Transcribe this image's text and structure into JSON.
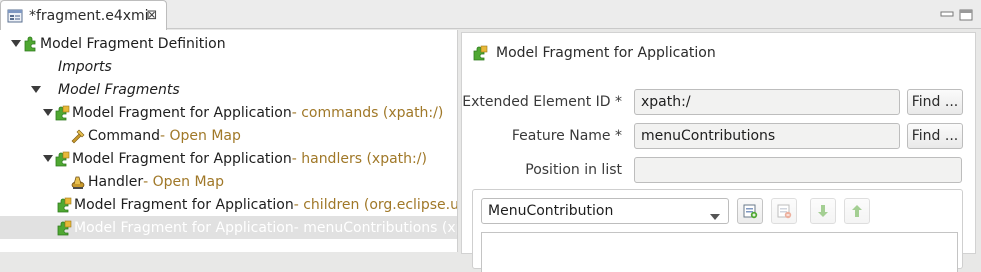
{
  "tab": {
    "title": "*fragment.e4xmi",
    "close_glyph": "⊠"
  },
  "tree": {
    "rows": [
      {
        "main": "Model Fragment Definition",
        "detail": ""
      },
      {
        "main": "Imports",
        "detail": ""
      },
      {
        "main": "Model Fragments",
        "detail": ""
      },
      {
        "main": "Model Fragment for Application",
        "detail": " - commands (xpath:/)"
      },
      {
        "main": "Command",
        "detail": " - Open Map"
      },
      {
        "main": "Model Fragment for Application",
        "detail": " - handlers (xpath:/)"
      },
      {
        "main": "Handler",
        "detail": " - Open Map"
      },
      {
        "main": "Model Fragment for Application",
        "detail": " - children (org.eclipse.ui."
      },
      {
        "main": "Model Fragment for Application",
        "detail": " - menuContributions (xpa"
      }
    ]
  },
  "details": {
    "header": "Model Fragment for Application",
    "extended_element_id": {
      "label": "Extended Element ID *",
      "value": "xpath:/",
      "button": "Find ..."
    },
    "feature_name": {
      "label": "Feature Name *",
      "value": "menuContributions",
      "button": "Find ..."
    },
    "position_in_list": {
      "label": "Position in list",
      "value": ""
    },
    "element_type": {
      "selected": "MenuContribution"
    }
  },
  "colors": {
    "detail_text": "#a07828",
    "selection": "#e1e1e1",
    "puzzle_green": "#4fa832",
    "puzzle_yellow": "#e8b838"
  }
}
